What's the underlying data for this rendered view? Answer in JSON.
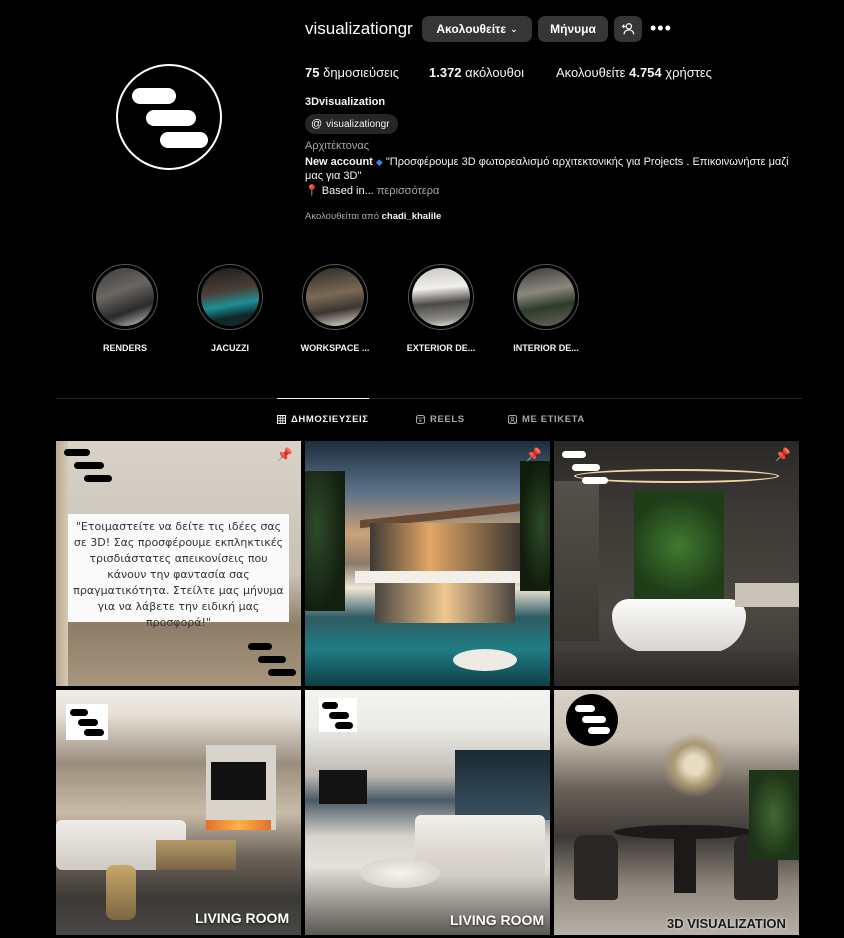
{
  "profile": {
    "username": "visualizationgr",
    "follow_label": "Ακολουθείτε",
    "message_label": "Μήνυμα",
    "posts_count": "75",
    "posts_label": "δημοσιεύσεις",
    "followers_count": "1.372",
    "followers_label": "ακόλουθοι",
    "following_prefix": "Ακολουθείτε",
    "following_count": "4.754",
    "following_suffix": "χρήστες",
    "full_name": "3Dvisualization",
    "threads_handle": "visualizationgr",
    "category": "Αρχιτέκτονας",
    "bio_bold": "New account",
    "bio_text": " \"Προσφέρουμε 3D φωτορεαλισμό αρχιτεκτονικής για Projects . Επικοινωνήστε μαζί μας για 3D\"",
    "bio_location": "Based in...",
    "bio_more": "περισσότερα",
    "followed_by_prefix": "Ακολουθείται από",
    "followed_by_user": "chadi_khalile"
  },
  "highlights": [
    {
      "label": "RENDERS"
    },
    {
      "label": "JACUZZI"
    },
    {
      "label": "WORKSPACE ..."
    },
    {
      "label": "EXTERIOR DE..."
    },
    {
      "label": "INTERIOR DE..."
    }
  ],
  "tabs": [
    {
      "label": "ΔΗΜΟΣΙΕΥΣΕΙΣ",
      "icon": "grid-icon",
      "active": true
    },
    {
      "label": "REELS",
      "icon": "reels-icon",
      "active": false
    },
    {
      "label": "ΜΕ ΕΤΙΚΕΤΑ",
      "icon": "tagged-icon",
      "active": false
    }
  ],
  "posts": [
    {
      "pinned": true,
      "card_text": "\"Ετοιμαστείτε να δείτε τις ιδέες σας σε 3D! Σας προσφέρουμε εκπληκτικές τρισδιάστατες απεικονίσεις που κάνουν την φαντασία σας πραγματικότητα. Στείλτε μας μήνυμα για να λάβετε την ειδική μας προσφορά!\""
    },
    {
      "pinned": true
    },
    {
      "pinned": true
    },
    {
      "caption": "LIVING ROOM"
    },
    {
      "caption": "LIVING ROOM"
    },
    {
      "caption": "3D VISUALIZATION"
    }
  ],
  "colors": {
    "background": "#000000",
    "button": "#363636",
    "muted_text": "#a8a8a8",
    "verified_blue": "#3b82f6"
  }
}
